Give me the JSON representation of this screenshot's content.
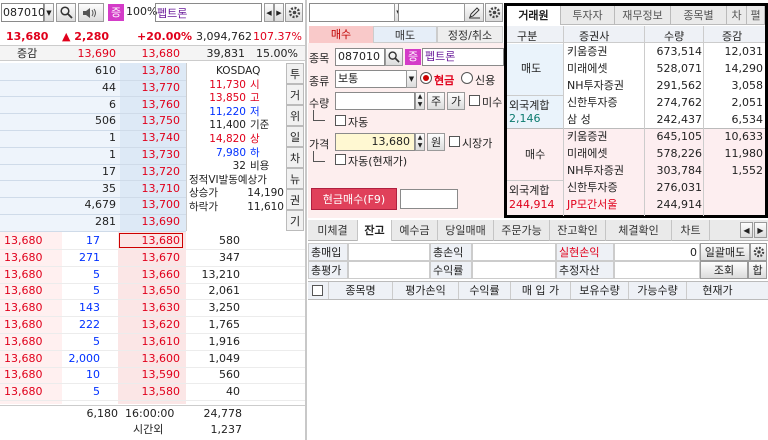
{
  "quote": {
    "code": "087010",
    "tag": "증",
    "margin": "100%",
    "name": "펩트론",
    "price": "13,680",
    "change": "▲ 2,280",
    "change_rate": "+20.00%",
    "volume": "3,094,762",
    "turnover": "107.37%",
    "diff_label": "증감",
    "ref_ask": "13,690",
    "ref_bid": "13,680",
    "cum_qty": "39,831",
    "cum_rate": "15.00%",
    "asks": [
      {
        "qty": "610",
        "price": "13,780"
      },
      {
        "qty": "44",
        "price": "13,770"
      },
      {
        "qty": "6",
        "price": "13,760"
      },
      {
        "qty": "506",
        "price": "13,750"
      },
      {
        "qty": "1",
        "price": "13,740"
      },
      {
        "qty": "1",
        "price": "13,730"
      },
      {
        "qty": "17",
        "price": "13,720"
      },
      {
        "qty": "35",
        "price": "13,710"
      },
      {
        "qty": "4,679",
        "price": "13,700"
      },
      {
        "qty": "281",
        "price": "13,690"
      }
    ],
    "info": [
      {
        "label": "KOSDAQ",
        "value": "",
        "color": "#222"
      },
      {
        "label": "11,730",
        "value": "시",
        "color": "#e0001b"
      },
      {
        "label": "13,850",
        "value": "고",
        "color": "#e0001b"
      },
      {
        "label": "11,220",
        "value": "저",
        "color": "#0030ff"
      },
      {
        "label": "11,400",
        "value": "기준",
        "color": "#222"
      },
      {
        "label": "14,820",
        "value": "상",
        "color": "#e0001b"
      },
      {
        "label": "7,980",
        "value": "하",
        "color": "#0030ff"
      },
      {
        "label": "32",
        "value": "비용",
        "color": "#222"
      },
      {
        "label": "정적VI발동예상가",
        "value": "",
        "color": "#222"
      },
      {
        "label": "상승가",
        "value": "14,190",
        "color": "#222"
      },
      {
        "label": "하락가",
        "value": "11,610",
        "color": "#222"
      }
    ],
    "side_tabs": [
      "투",
      "거",
      "위",
      "일",
      "차",
      "뉴",
      "권",
      "기"
    ],
    "bids": [
      {
        "exec": "13,680",
        "execq": "17",
        "price": "13,680",
        "qty": "580"
      },
      {
        "exec": "13,680",
        "execq": "271",
        "price": "13,670",
        "qty": "347"
      },
      {
        "exec": "13,680",
        "execq": "5",
        "price": "13,660",
        "qty": "13,210"
      },
      {
        "exec": "13,680",
        "execq": "5",
        "price": "13,650",
        "qty": "2,061"
      },
      {
        "exec": "13,680",
        "execq": "143",
        "price": "13,630",
        "qty": "3,250"
      },
      {
        "exec": "13,680",
        "execq": "222",
        "price": "13,620",
        "qty": "1,765"
      },
      {
        "exec": "13,680",
        "execq": "5",
        "price": "13,610",
        "qty": "1,916"
      },
      {
        "exec": "13,680",
        "execq": "2,000",
        "price": "13,600",
        "qty": "1,049"
      },
      {
        "exec": "13,680",
        "execq": "10",
        "price": "13,590",
        "qty": "560"
      },
      {
        "exec": "13,680",
        "execq": "5",
        "price": "13,580",
        "qty": "40"
      }
    ],
    "total_ask": "6,180",
    "time": "16:00:00",
    "total_bid": "24,778",
    "after_label": "시간외",
    "after_qty": "1,237"
  },
  "order": {
    "tabs": [
      "매수",
      "매도",
      "정정/취소"
    ],
    "code_label": "종목",
    "code": "087010",
    "tag": "증",
    "name": "펩트론",
    "type_label": "종류",
    "type_value": "보통",
    "cash_label": "현금",
    "credit_label": "신용",
    "qty_label": "수량",
    "qty_btn1": "주",
    "qty_btn2": "가",
    "misu_label": "미수",
    "auto_label": "자동",
    "price_label": "가격",
    "price": "13,680",
    "won": "원",
    "market_label": "시장가",
    "auto_current": "자동(현재가)",
    "submit": "현금매수(F9)"
  },
  "brokers": {
    "tabs": [
      "거래원",
      "투자자",
      "재무정보",
      "종목별",
      "차",
      "펼"
    ],
    "headers": [
      "구분",
      "증권사",
      "수량",
      "증감"
    ],
    "sell_label": "매도",
    "sell": [
      {
        "name": "키움증권",
        "qty": "673,514",
        "diff": "12,031"
      },
      {
        "name": "미래에셋",
        "qty": "528,071",
        "diff": "14,290"
      },
      {
        "name": "NH투자증권",
        "qty": "291,562",
        "diff": "3,058"
      },
      {
        "name": "신한투자증",
        "qty": "274,762",
        "diff": "2,051"
      },
      {
        "name": "삼 성",
        "qty": "242,437",
        "diff": "6,534"
      }
    ],
    "sell_foreign_label": "외국계합",
    "sell_foreign": "2,146",
    "buy_label": "매수",
    "buy": [
      {
        "name": "키움증권",
        "qty": "645,105",
        "diff": "10,633"
      },
      {
        "name": "미래에셋",
        "qty": "578,226",
        "diff": "11,980"
      },
      {
        "name": "NH투자증권",
        "qty": "303,784",
        "diff": "1,552"
      },
      {
        "name": "신한투자증",
        "qty": "276,031",
        "diff": ""
      },
      {
        "name": "JP모간서울",
        "qty": "244,914",
        "diff": ""
      }
    ],
    "buy_foreign_label": "외국계합",
    "buy_foreign": "244,914"
  },
  "balance": {
    "tabs": [
      "미체결",
      "잔고",
      "예수금",
      "당일매매",
      "주문가능",
      "잔고확인",
      "체결확인",
      "차트"
    ],
    "f1": "총매입",
    "f2": "총손익",
    "f3": "실현손익",
    "f3_value": "0",
    "f4": "일괄매도",
    "f5": "총평가",
    "f6": "수익률",
    "f7": "추정자산",
    "f8": "조회",
    "f9": "합",
    "cols": [
      "종목명",
      "평가손익",
      "수익률",
      "매 입 가",
      "보유수량",
      "가능수량",
      "현재가"
    ]
  }
}
